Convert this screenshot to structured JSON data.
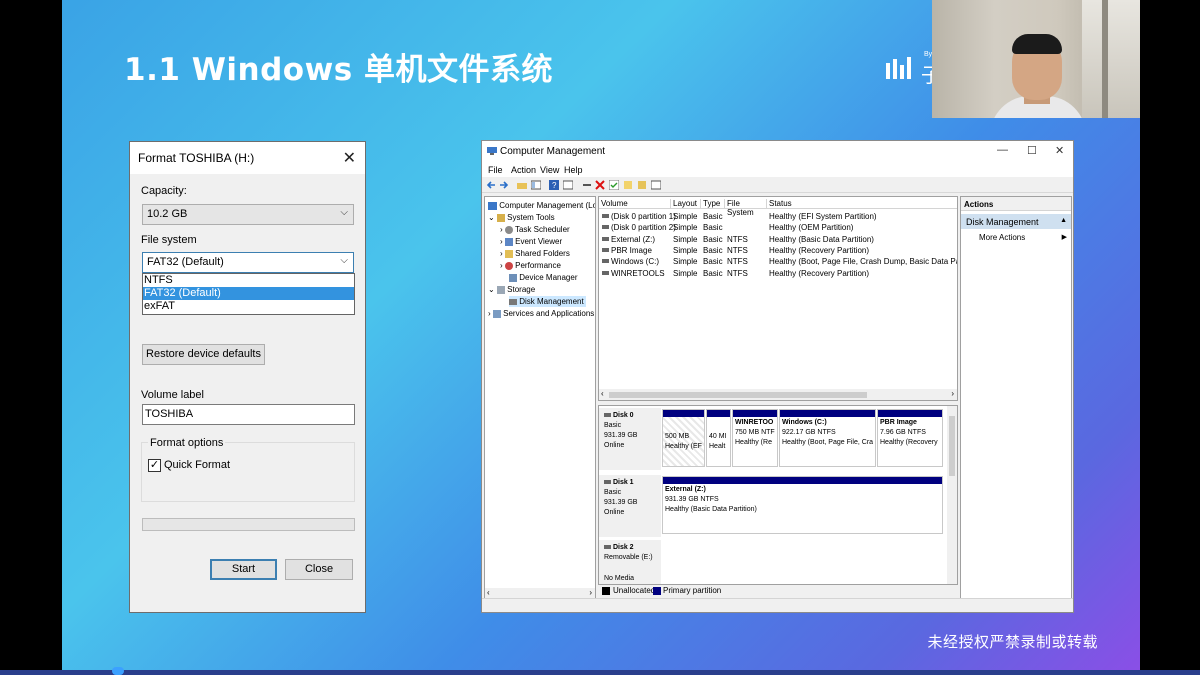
{
  "slide": {
    "title": "1.1 Windows 单机文件系统",
    "logo_by": "By",
    "logo_text": "子",
    "watermark": "未经授权严禁录制或转载"
  },
  "format_dialog": {
    "title": "Format TOSHIBA (H:)",
    "capacity_label": "Capacity:",
    "capacity_value": "10.2 GB",
    "filesystem_label": "File system",
    "filesystem_value": "FAT32 (Default)",
    "filesystem_options": [
      "NTFS",
      "FAT32 (Default)",
      "exFAT"
    ],
    "restore_defaults": "Restore device defaults",
    "volume_label_label": "Volume label",
    "volume_label_value": "TOSHIBA",
    "format_options_label": "Format options",
    "quick_format_label": "Quick Format",
    "quick_format_checked": "✓",
    "start_button": "Start",
    "close_button": "Close",
    "close_icon": "✕"
  },
  "computer_management": {
    "title": "Computer Management",
    "controls": [
      "—",
      "☐",
      "✕"
    ],
    "menu": [
      "File",
      "Action",
      "View",
      "Help"
    ],
    "tree": {
      "root": "Computer Management (Local",
      "system_tools": "System Tools",
      "task_scheduler": "Task Scheduler",
      "event_viewer": "Event Viewer",
      "shared_folders": "Shared Folders",
      "performance": "Performance",
      "device_manager": "Device Manager",
      "storage": "Storage",
      "disk_management": "Disk Management",
      "services": "Services and Applications"
    },
    "volume_columns": [
      "Volume",
      "Layout",
      "Type",
      "File System",
      "Status"
    ],
    "volumes": [
      {
        "volume": "(Disk 0 partition 1)",
        "layout": "Simple",
        "type": "Basic",
        "fs": "",
        "status": "Healthy (EFI System Partition)"
      },
      {
        "volume": "(Disk 0 partition 2)",
        "layout": "Simple",
        "type": "Basic",
        "fs": "",
        "status": "Healthy (OEM Partition)"
      },
      {
        "volume": "External (Z:)",
        "layout": "Simple",
        "type": "Basic",
        "fs": "NTFS",
        "status": "Healthy (Basic Data Partition)"
      },
      {
        "volume": "PBR Image",
        "layout": "Simple",
        "type": "Basic",
        "fs": "NTFS",
        "status": "Healthy (Recovery Partition)"
      },
      {
        "volume": "Windows (C:)",
        "layout": "Simple",
        "type": "Basic",
        "fs": "NTFS",
        "status": "Healthy (Boot, Page File, Crash Dump, Basic Data Partition)"
      },
      {
        "volume": "WINRETOOLS",
        "layout": "Simple",
        "type": "Basic",
        "fs": "NTFS",
        "status": "Healthy (Recovery Partition)"
      }
    ],
    "disks": {
      "disk0": {
        "name": "Disk 0",
        "type": "Basic",
        "size": "931.39 GB",
        "state": "Online"
      },
      "disk0_parts": {
        "p1_size": "500 MB",
        "p1_status": "Healthy (EF",
        "p2_size": "40 MI",
        "p2_status": "Healt",
        "p3_name": "WINRETOO",
        "p3_size": "750 MB NTF",
        "p3_status": "Healthy (Re",
        "p4_name": "Windows  (C:)",
        "p4_size": "922.17 GB NTFS",
        "p4_status": "Healthy (Boot, Page File, Cra",
        "p5_name": "PBR Image",
        "p5_size": "7.96 GB NTFS",
        "p5_status": "Healthy (Recovery"
      },
      "disk1": {
        "name": "Disk 1",
        "type": "Basic",
        "size": "931.39 GB",
        "state": "Online"
      },
      "disk1_part": {
        "name": "External  (Z:)",
        "size": "931.39 GB NTFS",
        "status": "Healthy (Basic Data Partition)"
      },
      "disk2": {
        "name": "Disk 2",
        "type": "Removable (E:)",
        "state": "No Media"
      }
    },
    "legend": {
      "unallocated": "Unallocated",
      "primary": "Primary partition"
    },
    "actions": {
      "header": "Actions",
      "selected": "Disk Management",
      "more": "More Actions"
    }
  },
  "colors": {
    "partition_header": "#00007f",
    "selection": "#3393df",
    "accent": "#3c7fb1"
  }
}
